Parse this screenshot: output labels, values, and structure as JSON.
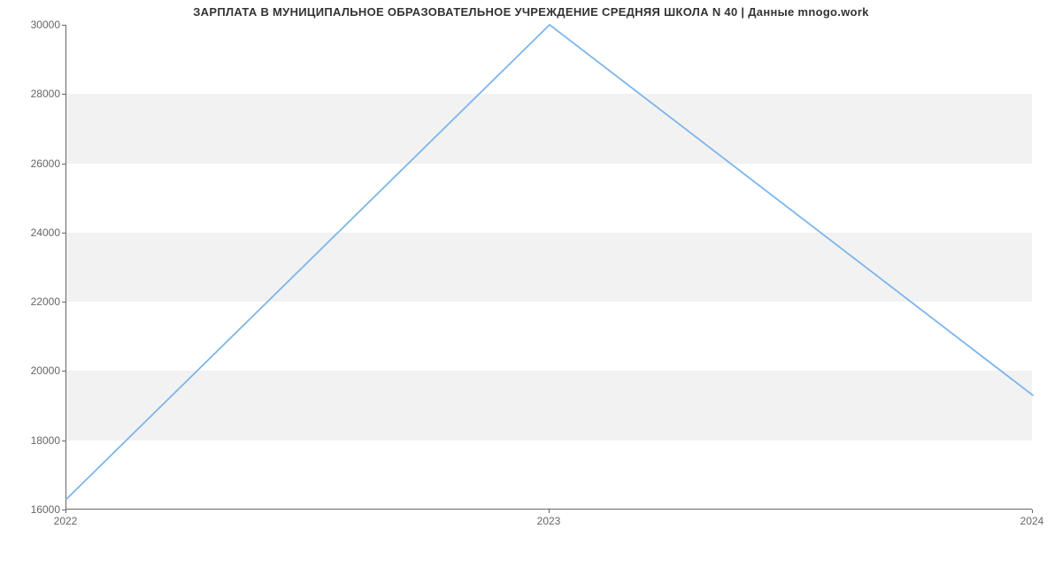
{
  "chart_data": {
    "type": "line",
    "title": "ЗАРПЛАТА В МУНИЦИПАЛЬНОЕ ОБРАЗОВАТЕЛЬНОЕ УЧРЕЖДЕНИЕ СРЕДНЯЯ ШКОЛА N 40 | Данные mnogo.work",
    "xlabel": "",
    "ylabel": "",
    "x_ticks": [
      "2022",
      "2023",
      "2024"
    ],
    "y_ticks": [
      16000,
      18000,
      20000,
      22000,
      24000,
      26000,
      28000,
      30000
    ],
    "ylim": [
      16000,
      30000
    ],
    "x": [
      2022,
      2023,
      2024
    ],
    "values": [
      16300,
      30000,
      19300
    ],
    "series_color": "#7cb5ec"
  }
}
